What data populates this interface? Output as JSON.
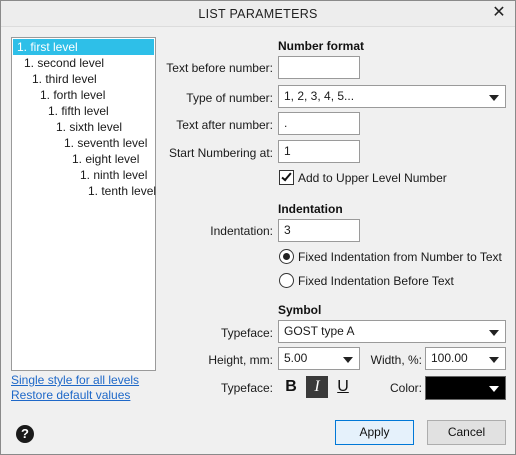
{
  "dialog": {
    "title": "LIST PARAMETERS"
  },
  "levels": [
    "1. first level",
    "1. second level",
    "1. third level",
    "1. forth level",
    "1. fifth level",
    "1. sixth level",
    "1. seventh level",
    "1. eight level",
    "1. ninth level",
    "1. tenth level"
  ],
  "selected_level": 0,
  "links": {
    "single_style": "Single style for all levels",
    "restore_defaults": "Restore default values"
  },
  "number_format": {
    "heading": "Number format",
    "text_before_label": "Text before number:",
    "text_before_value": "",
    "type_label": "Type of number:",
    "type_value": "1, 2, 3, 4, 5...",
    "text_after_label": "Text after number:",
    "text_after_value": ".",
    "start_label": "Start Numbering at:",
    "start_value": "1",
    "add_upper_label": "Add to Upper Level Number",
    "add_upper_checked": true
  },
  "indentation": {
    "heading": "Indentation",
    "label": "Indentation:",
    "value": "3",
    "option_fixed_number_to_text": "Fixed Indentation from Number to Text",
    "option_fixed_before_text": "Fixed Indentation Before Text",
    "selected_option": "fixed_number_to_text"
  },
  "symbol": {
    "heading": "Symbol",
    "typeface_label": "Typeface:",
    "typeface_value": "GOST type A",
    "height_label": "Height, mm:",
    "height_value": "5.00",
    "width_label": "Width, %:",
    "width_value": "100.00",
    "style_label": "Typeface:",
    "bold_glyph": "B",
    "italic_glyph": "I",
    "underline_glyph": "U",
    "italic_active": true,
    "color_label": "Color:",
    "color_value": "#000000"
  },
  "buttons": {
    "apply": "Apply",
    "cancel": "Cancel",
    "help": "?"
  },
  "colors": {
    "selection": "#2ebfe8",
    "link": "#1e68c8",
    "accent_border": "#0078d7"
  }
}
